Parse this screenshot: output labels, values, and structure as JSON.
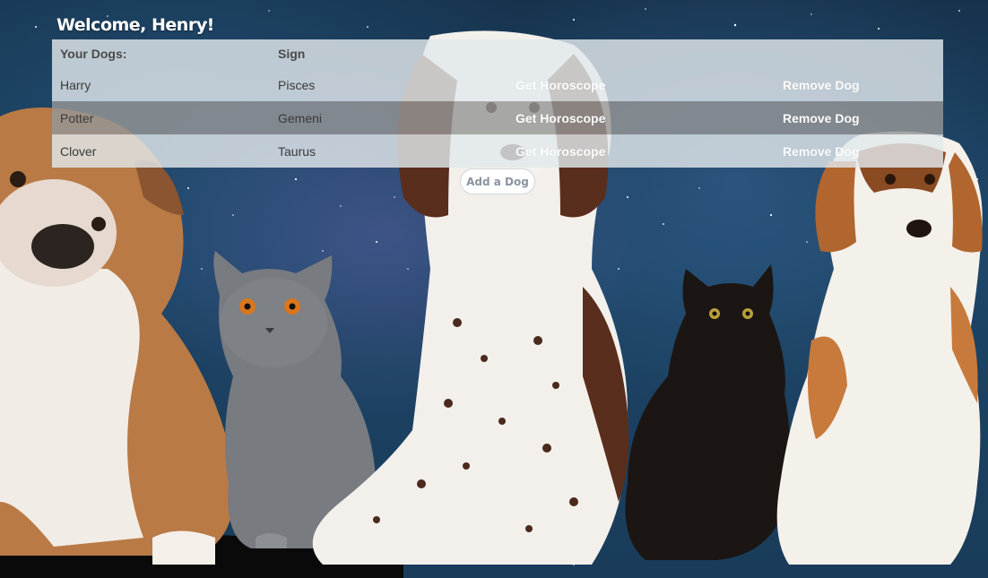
{
  "header": {
    "welcome": "Welcome, Henry!"
  },
  "table": {
    "columns": {
      "dogs": "Your Dogs:",
      "sign": "Sign"
    },
    "rows": [
      {
        "name": "Harry",
        "sign": "Pisces",
        "horoscope_label": "Get Horoscope",
        "remove_label": "Remove Dog"
      },
      {
        "name": "Potter",
        "sign": "Gemeni",
        "horoscope_label": "Get Horoscope",
        "remove_label": "Remove Dog"
      },
      {
        "name": "Clover",
        "sign": "Taurus",
        "horoscope_label": "Get Horoscope",
        "remove_label": "Remove Dog"
      }
    ]
  },
  "actions": {
    "add_dog_label": "Add a Dog"
  },
  "background": {
    "scene": "starry-space",
    "animals": [
      "bulldog",
      "gray-cat",
      "spaniel",
      "black-cat",
      "beagle"
    ]
  }
}
